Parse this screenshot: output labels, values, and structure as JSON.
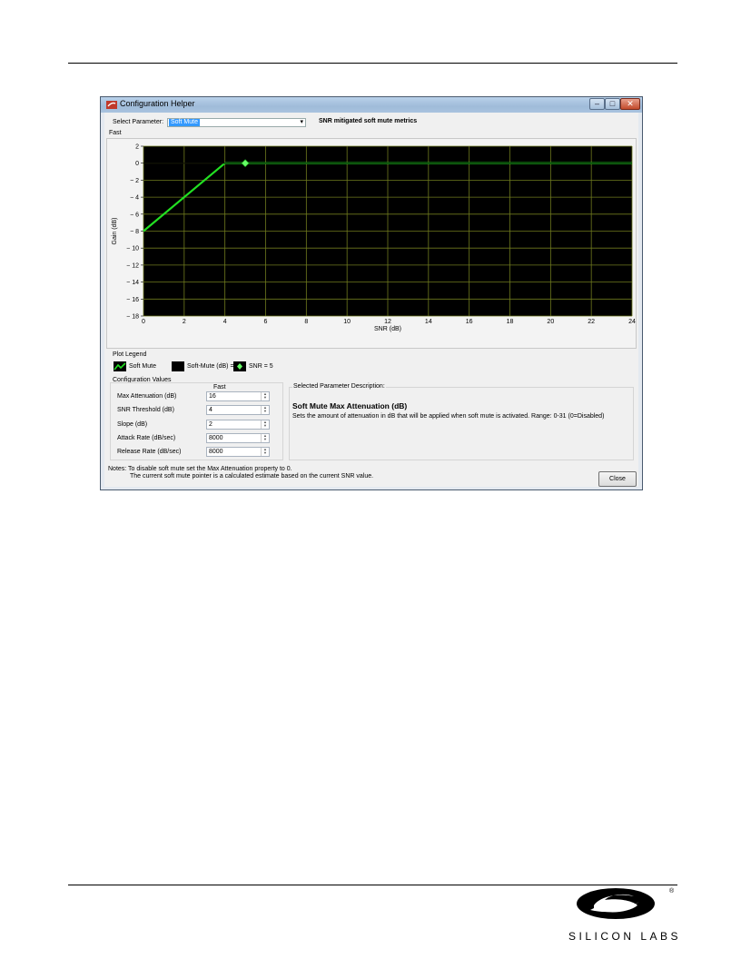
{
  "window": {
    "title": "Configuration Helper",
    "min_glyph": "–",
    "max_glyph": "□",
    "close_glyph": "✕"
  },
  "select_parameter": {
    "label": "Select Parameter:",
    "value": "Soft Mute",
    "dropdown_glyph": "▾"
  },
  "metric_title": "SNR mitigated soft mute metrics",
  "plot_caption": "Fast",
  "chart_data": {
    "type": "line",
    "title": "",
    "xlabel": "SNR (dB)",
    "ylabel": "Gain (dB)",
    "xlim": [
      0,
      24
    ],
    "ylim": [
      -18,
      2
    ],
    "x_ticks": [
      0,
      2,
      4,
      6,
      8,
      10,
      12,
      14,
      16,
      18,
      20,
      22,
      24
    ],
    "y_ticks": [
      2,
      0,
      -2,
      -4,
      -6,
      -8,
      -10,
      -12,
      -14,
      -16,
      -18
    ],
    "grid": true,
    "background": "#000000",
    "grid_color": "#6f7a1e",
    "series": [
      {
        "name": "Soft Mute",
        "color": "#22e022",
        "x": [
          0,
          4,
          24
        ],
        "y": [
          -8,
          0,
          0
        ]
      },
      {
        "name": "Soft-Mute (dB) = 0",
        "color": "#000000",
        "x": [
          0,
          24
        ],
        "y": [
          0,
          0
        ]
      },
      {
        "name": "SNR = 5",
        "color": "#66ff66",
        "marker": "diamond",
        "x": [
          5
        ],
        "y": [
          0
        ]
      }
    ]
  },
  "legend": {
    "title": "Plot Legend",
    "items": [
      "Soft Mute",
      "Soft-Mute (dB) = 0",
      "SNR = 5"
    ]
  },
  "config": {
    "title": "Configuration Values",
    "column": "Fast",
    "rows": [
      {
        "label": "Max Attenuation (dB)",
        "value": "16"
      },
      {
        "label": "SNR Threshold (dB)",
        "value": "4"
      },
      {
        "label": "Slope (dB)",
        "value": "2"
      },
      {
        "label": "Attack Rate (dB/sec)",
        "value": "8000"
      },
      {
        "label": "Release Rate (dB/sec)",
        "value": "8000"
      }
    ]
  },
  "description": {
    "header": "Selected Parameter Description:",
    "title": "Soft Mute Max Attenuation (dB)",
    "text": "Sets the amount of attenuation in dB that will be applied when soft mute is activated. Range: 0-31 (0=Disabled)"
  },
  "notes": {
    "line1": "Notes: To disable soft mute set the Max Attenuation property to 0.",
    "line2": "The current soft mute pointer is a calculated estimate based on the current SNR value."
  },
  "close_label": "Close",
  "logo_text": "SILICON LABS",
  "logo_mark": "®"
}
